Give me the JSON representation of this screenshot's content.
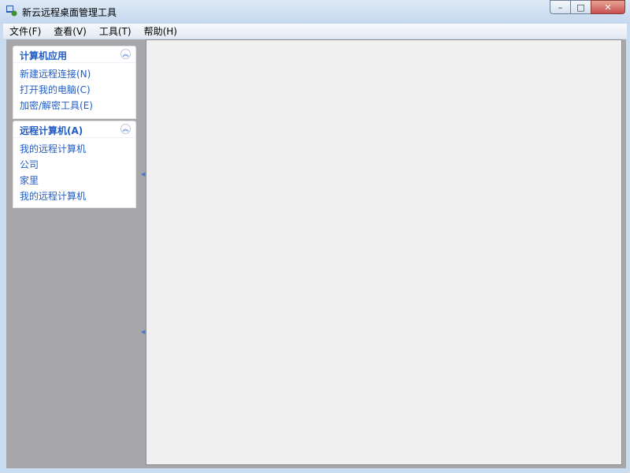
{
  "window": {
    "title": "新云远程桌面管理工具",
    "minimize_glyph": "–",
    "maximize_glyph": "□",
    "close_glyph": "✕"
  },
  "menubar": {
    "items": [
      {
        "label": "文件(F)"
      },
      {
        "label": "查看(V)"
      },
      {
        "label": "工具(T)"
      },
      {
        "label": "帮助(H)"
      }
    ]
  },
  "sidebar": {
    "groups": [
      {
        "title": "计算机应用",
        "collapse_icon": "double-chevron-up-icon",
        "items": [
          {
            "label": "新建远程连接(N)"
          },
          {
            "label": "打开我的电脑(C)"
          },
          {
            "label": "加密/解密工具(E)"
          }
        ]
      },
      {
        "title": "远程计算机(A)",
        "collapse_icon": "double-chevron-up-icon",
        "items": [
          {
            "label": "我的远程计算机"
          },
          {
            "label": "公司"
          },
          {
            "label": "家里"
          },
          {
            "label": "我的远程计算机"
          }
        ]
      }
    ]
  },
  "colors": {
    "link": "#215dc6",
    "panel_bg": "#a7a6aa",
    "main_bg": "#f0f0f0"
  }
}
